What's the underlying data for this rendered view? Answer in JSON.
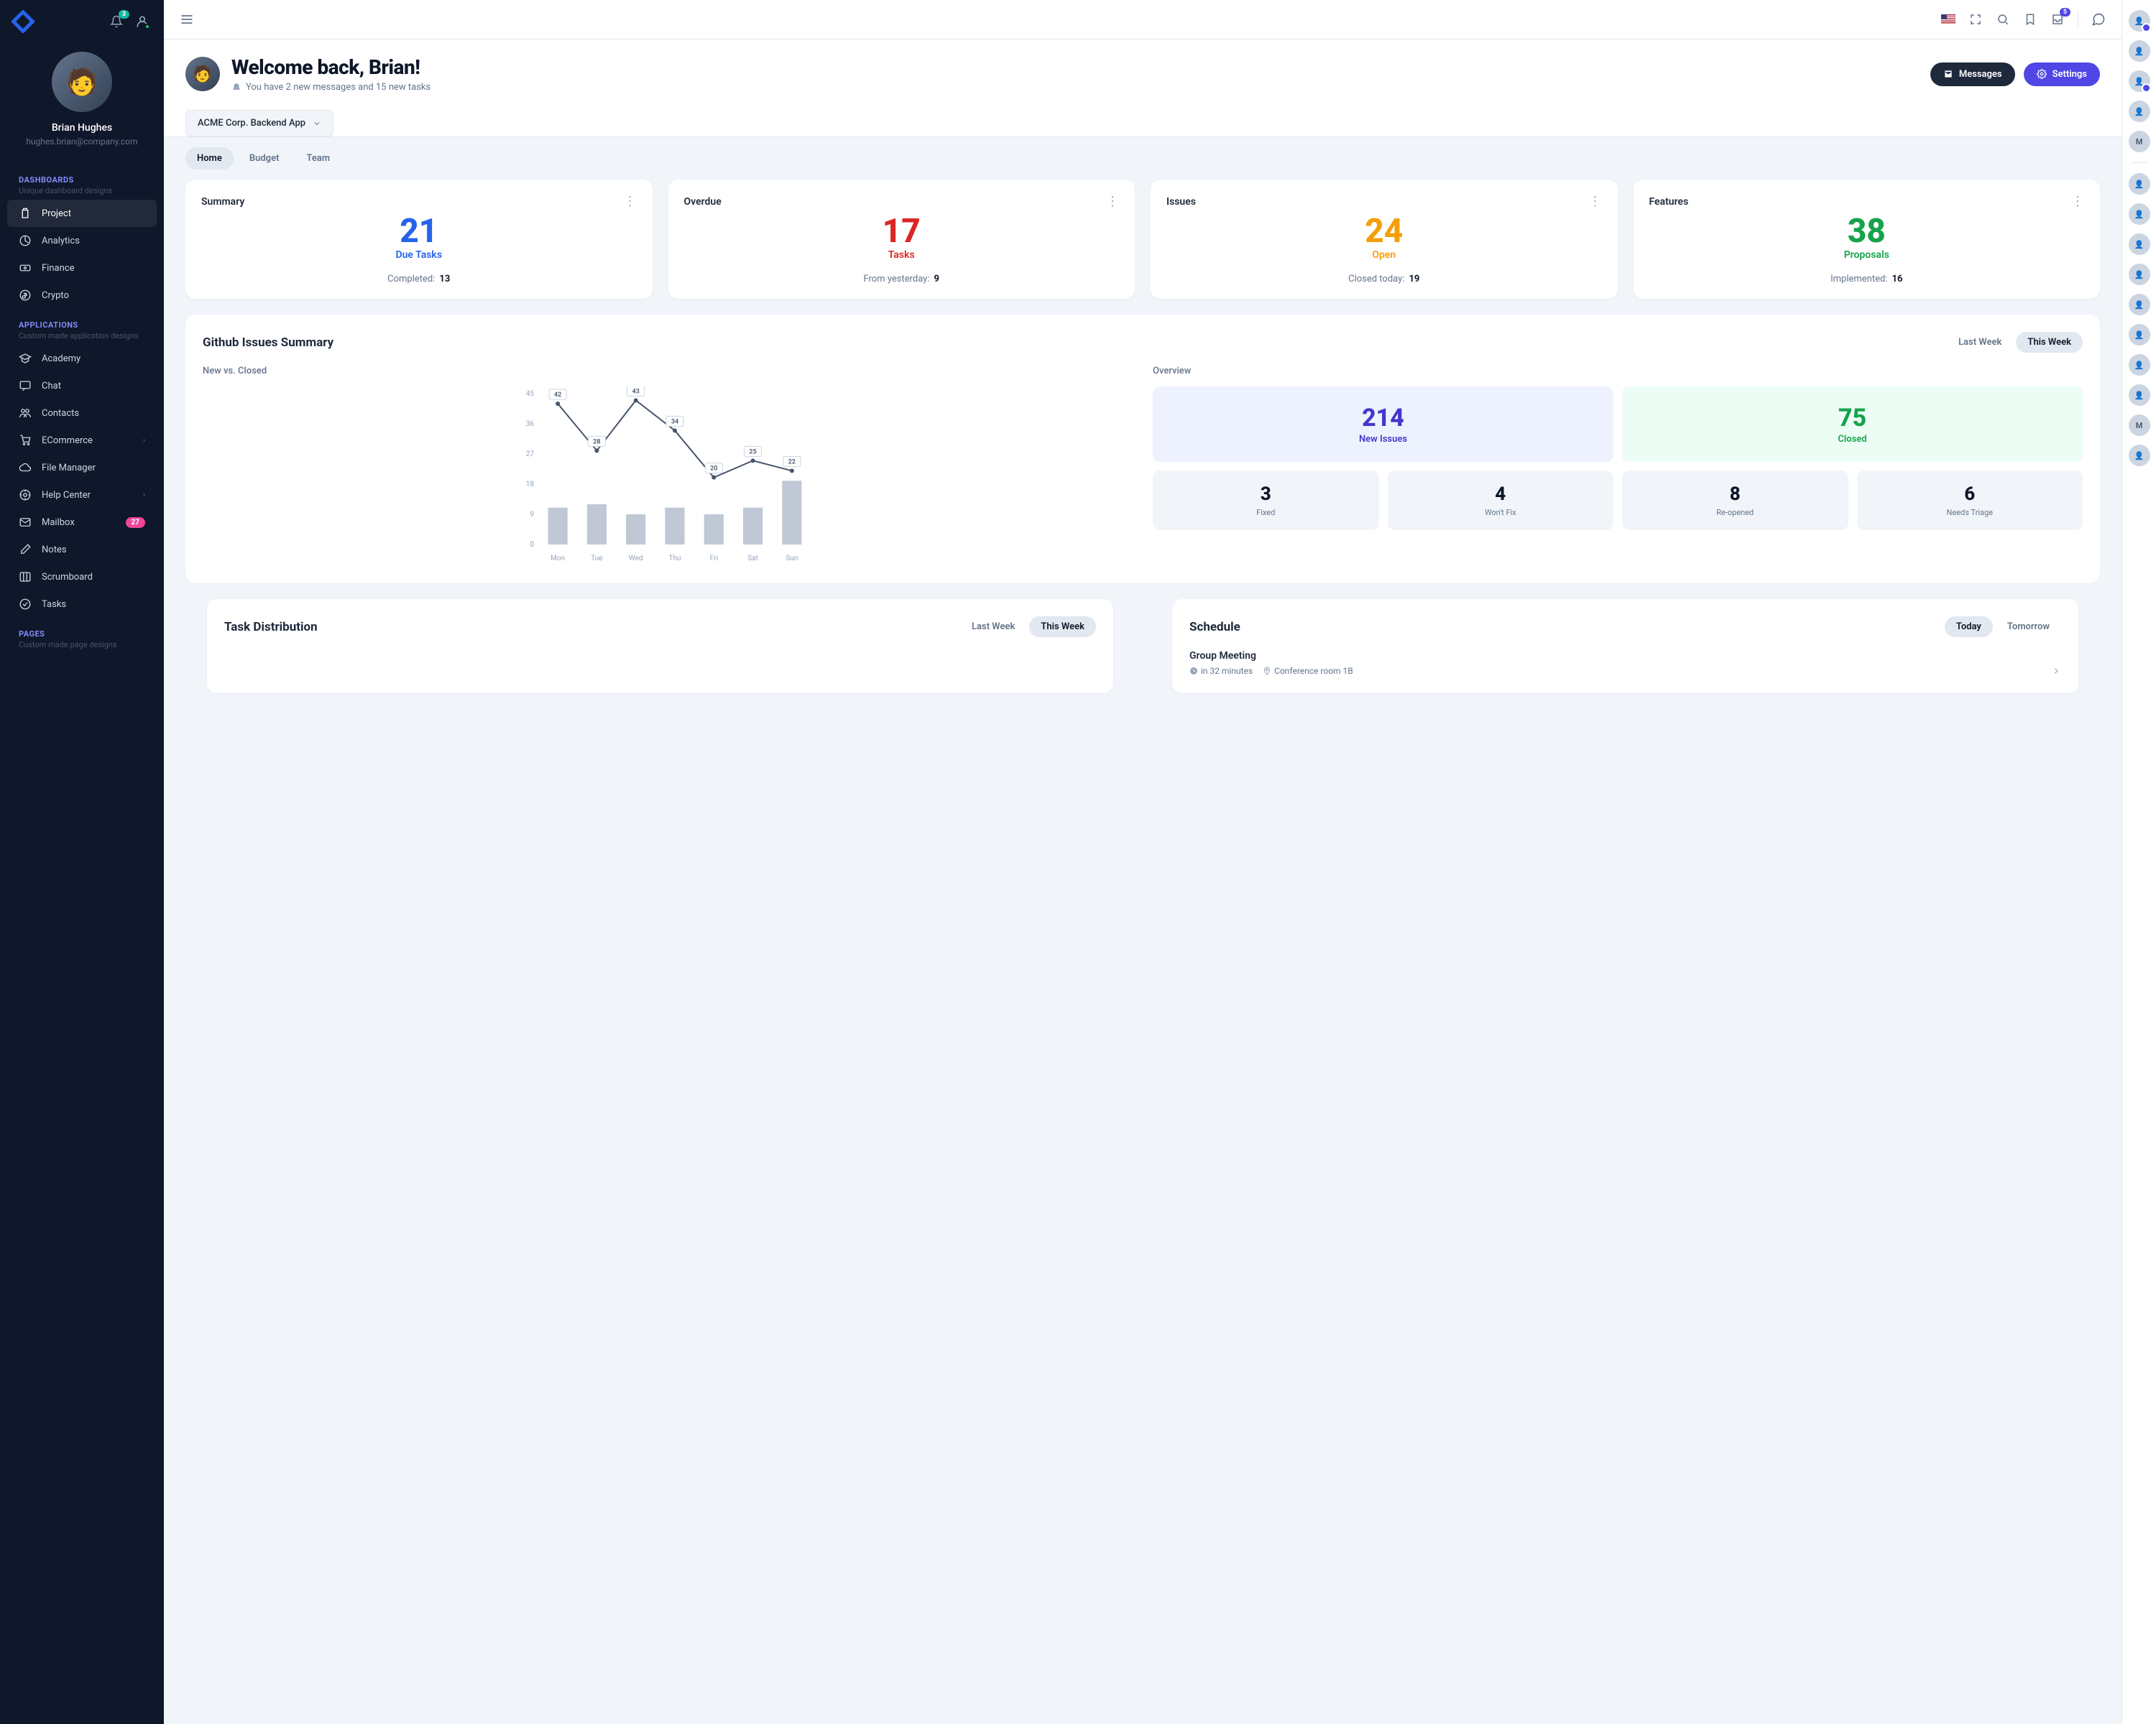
{
  "sidebar": {
    "notifBadge": "3",
    "user": {
      "name": "Brian Hughes",
      "email": "hughes.brian@company.com"
    },
    "groups": [
      {
        "header": "DASHBOARDS",
        "sub": "Unique dashboard designs",
        "items": [
          {
            "icon": "clipboard",
            "label": "Project",
            "active": true
          },
          {
            "icon": "chart",
            "label": "Analytics"
          },
          {
            "icon": "cash",
            "label": "Finance"
          },
          {
            "icon": "dollar",
            "label": "Crypto"
          }
        ]
      },
      {
        "header": "APPLICATIONS",
        "sub": "Custom made application designs",
        "items": [
          {
            "icon": "cap",
            "label": "Academy"
          },
          {
            "icon": "chat",
            "label": "Chat"
          },
          {
            "icon": "users",
            "label": "Contacts"
          },
          {
            "icon": "cart",
            "label": "ECommerce",
            "chevron": true
          },
          {
            "icon": "cloud",
            "label": "File Manager"
          },
          {
            "icon": "help",
            "label": "Help Center",
            "chevron": true
          },
          {
            "icon": "mail",
            "label": "Mailbox",
            "pill": "27"
          },
          {
            "icon": "pencil",
            "label": "Notes"
          },
          {
            "icon": "columns",
            "label": "Scrumboard"
          },
          {
            "icon": "check",
            "label": "Tasks"
          }
        ]
      },
      {
        "header": "PAGES",
        "sub": "Custom made page designs",
        "items": []
      }
    ]
  },
  "topbar": {
    "inboxBadge": "5"
  },
  "hero": {
    "welcome": "Welcome back, Brian!",
    "notif": "You have 2 new messages and 15 new tasks",
    "messagesBtn": "Messages",
    "settingsBtn": "Settings",
    "appSelect": "ACME Corp. Backend App"
  },
  "tabs": [
    "Home",
    "Budget",
    "Team"
  ],
  "summaryCards": [
    {
      "title": "Summary",
      "value": "21",
      "label": "Due Tasks",
      "footKey": "Completed:",
      "footVal": "13",
      "color": "c-blue"
    },
    {
      "title": "Overdue",
      "value": "17",
      "label": "Tasks",
      "footKey": "From yesterday:",
      "footVal": "9",
      "color": "c-red"
    },
    {
      "title": "Issues",
      "value": "24",
      "label": "Open",
      "footKey": "Closed today:",
      "footVal": "19",
      "color": "c-amber"
    },
    {
      "title": "Features",
      "value": "38",
      "label": "Proposals",
      "footKey": "Implemented:",
      "footVal": "16",
      "color": "c-green"
    }
  ],
  "github": {
    "title": "Github Issues Summary",
    "seg": [
      "Last Week",
      "This Week"
    ],
    "newVsClosed": "New vs. Closed",
    "overview": "Overview",
    "top": [
      {
        "num": "214",
        "label": "New Issues",
        "cls": "ov-indigo",
        "color": "c-indigo"
      },
      {
        "num": "75",
        "label": "Closed",
        "cls": "ov-green",
        "color": "c-green"
      }
    ],
    "bottom": [
      {
        "num": "3",
        "label": "Fixed"
      },
      {
        "num": "4",
        "label": "Won't Fix"
      },
      {
        "num": "8",
        "label": "Re-opened"
      },
      {
        "num": "6",
        "label": "Needs Triage"
      }
    ]
  },
  "taskDist": {
    "title": "Task Distribution",
    "seg": [
      "Last Week",
      "This Week"
    ]
  },
  "schedule": {
    "title": "Schedule",
    "seg": [
      "Today",
      "Tomorrow"
    ],
    "event": "Group Meeting",
    "time": "in 32 minutes",
    "room": "Conference room 1B"
  },
  "contacts": [
    {
      "t": "",
      "on": true
    },
    {
      "t": ""
    },
    {
      "t": "",
      "on": true
    },
    {
      "t": ""
    },
    {
      "t": "M"
    },
    {
      "sep": true
    },
    {
      "t": ""
    },
    {
      "t": ""
    },
    {
      "t": ""
    },
    {
      "t": ""
    },
    {
      "t": ""
    },
    {
      "t": ""
    },
    {
      "t": ""
    },
    {
      "t": ""
    },
    {
      "t": "M"
    },
    {
      "t": ""
    }
  ],
  "chart_data": {
    "type": "bar+line",
    "categories": [
      "Mon",
      "Tue",
      "Wed",
      "Thu",
      "Fri",
      "Sat",
      "Sun"
    ],
    "series": [
      {
        "name": "New (line)",
        "values": [
          42,
          28,
          43,
          34,
          20,
          25,
          22
        ]
      },
      {
        "name": "Closed (bar)",
        "values": [
          11,
          12,
          9,
          11,
          9,
          11,
          19
        ]
      }
    ],
    "yTicks": [
      0,
      9,
      18,
      27,
      36,
      45
    ],
    "ylim": [
      0,
      45
    ]
  }
}
